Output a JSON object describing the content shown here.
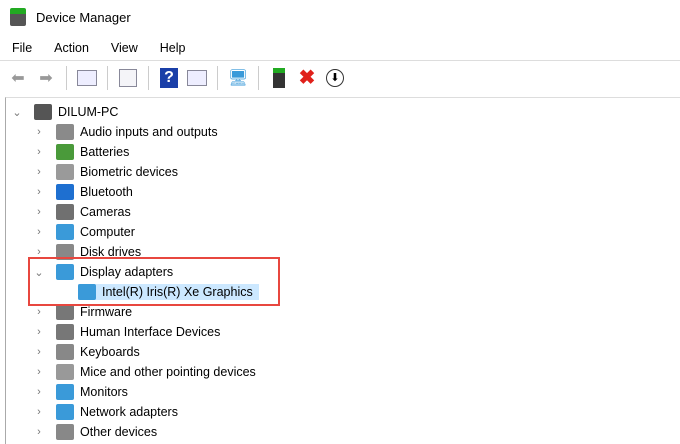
{
  "window": {
    "title": "Device Manager"
  },
  "menu": [
    "File",
    "Action",
    "View",
    "Help"
  ],
  "toolbar": [
    "back-icon",
    "forward-icon",
    "show-hide-console-tree-icon",
    "properties-icon",
    "help-icon",
    "show-action-pane-icon",
    "scan-hardware-icon",
    "update-driver-icon",
    "uninstall-icon",
    "disable-icon"
  ],
  "tree": {
    "root": "DILUM-PC",
    "items": [
      {
        "label": "Audio inputs and outputs",
        "icon": "speaker-icon",
        "color": "#8a8a8a"
      },
      {
        "label": "Batteries",
        "icon": "battery-icon",
        "color": "#4a9a3a"
      },
      {
        "label": "Biometric devices",
        "icon": "fingerprint-icon",
        "color": "#9a9a9a"
      },
      {
        "label": "Bluetooth",
        "icon": "bluetooth-icon",
        "color": "#1e6fd0"
      },
      {
        "label": "Cameras",
        "icon": "camera-icon",
        "color": "#707070"
      },
      {
        "label": "Computer",
        "icon": "computer-icon",
        "color": "#3a9ad9"
      },
      {
        "label": "Disk drives",
        "icon": "disk-icon",
        "color": "#888888"
      },
      {
        "label": "Display adapters",
        "icon": "display-adapter-icon",
        "color": "#3a9ad9",
        "expanded": true,
        "children": [
          {
            "label": "Intel(R) Iris(R) Xe Graphics",
            "icon": "display-adapter-icon",
            "selected": true
          }
        ]
      },
      {
        "label": "Firmware",
        "icon": "firmware-icon",
        "color": "#777777"
      },
      {
        "label": "Human Interface Devices",
        "icon": "hid-icon",
        "color": "#777777"
      },
      {
        "label": "Keyboards",
        "icon": "keyboard-icon",
        "color": "#888888"
      },
      {
        "label": "Mice and other pointing devices",
        "icon": "mouse-icon",
        "color": "#999999"
      },
      {
        "label": "Monitors",
        "icon": "monitor-icon",
        "color": "#3a9ad9"
      },
      {
        "label": "Network adapters",
        "icon": "network-icon",
        "color": "#3a9ad9"
      },
      {
        "label": "Other devices",
        "icon": "unknown-device-icon",
        "color": "#888888"
      }
    ]
  },
  "highlight_color": "#e8473f"
}
